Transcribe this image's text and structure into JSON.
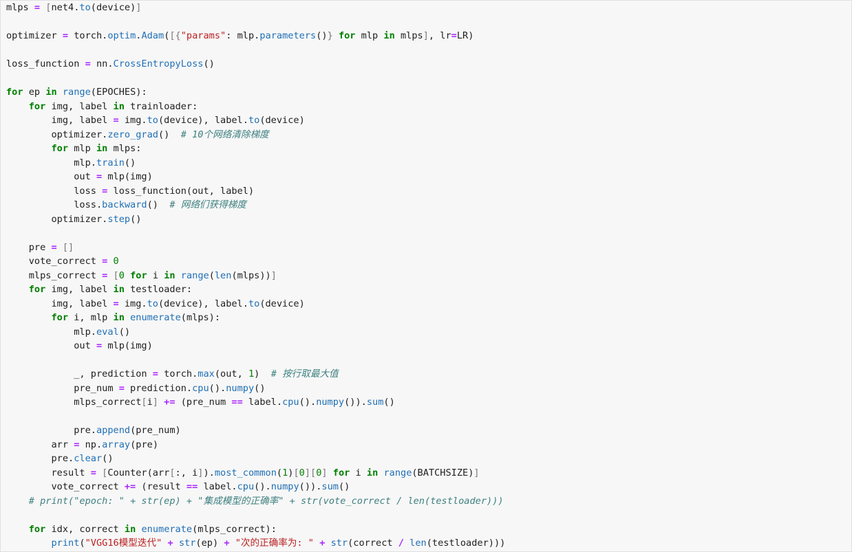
{
  "editor": {
    "lines": [
      [
        [
          "plain",
          "mlps "
        ],
        [
          "op",
          "="
        ],
        [
          "plain",
          " "
        ],
        [
          "br",
          "["
        ],
        [
          "plain",
          "net4."
        ],
        [
          "fn",
          "to"
        ],
        [
          "plain",
          "(device)"
        ],
        [
          "br",
          "]"
        ]
      ],
      [],
      [
        [
          "plain",
          "optimizer "
        ],
        [
          "op",
          "="
        ],
        [
          "plain",
          " torch."
        ],
        [
          "fn",
          "optim"
        ],
        [
          "plain",
          "."
        ],
        [
          "fn",
          "Adam"
        ],
        [
          "plain",
          "("
        ],
        [
          "br",
          "[{"
        ],
        [
          "str",
          "\"params\""
        ],
        [
          "plain",
          ": mlp."
        ],
        [
          "fn",
          "parameters"
        ],
        [
          "plain",
          "()"
        ],
        [
          "br",
          "}"
        ],
        [
          "plain",
          " "
        ],
        [
          "kw",
          "for"
        ],
        [
          "plain",
          " mlp "
        ],
        [
          "kw",
          "in"
        ],
        [
          "plain",
          " mlps"
        ],
        [
          "br",
          "]"
        ],
        [
          "plain",
          ", lr"
        ],
        [
          "op",
          "="
        ],
        [
          "plain",
          "LR)"
        ]
      ],
      [],
      [
        [
          "plain",
          "loss_function "
        ],
        [
          "op",
          "="
        ],
        [
          "plain",
          " nn."
        ],
        [
          "fn",
          "CrossEntropyLoss"
        ],
        [
          "plain",
          "()"
        ]
      ],
      [],
      [
        [
          "kw",
          "for"
        ],
        [
          "plain",
          " ep "
        ],
        [
          "kw",
          "in"
        ],
        [
          "plain",
          " "
        ],
        [
          "fn",
          "range"
        ],
        [
          "plain",
          "(EPOCHES):"
        ]
      ],
      [
        [
          "plain",
          "    "
        ],
        [
          "kw",
          "for"
        ],
        [
          "plain",
          " img, label "
        ],
        [
          "kw",
          "in"
        ],
        [
          "plain",
          " trainloader:"
        ]
      ],
      [
        [
          "plain",
          "        img, label "
        ],
        [
          "op",
          "="
        ],
        [
          "plain",
          " img."
        ],
        [
          "fn",
          "to"
        ],
        [
          "plain",
          "(device), label."
        ],
        [
          "fn",
          "to"
        ],
        [
          "plain",
          "(device)"
        ]
      ],
      [
        [
          "plain",
          "        optimizer."
        ],
        [
          "fn",
          "zero_grad"
        ],
        [
          "plain",
          "()  "
        ],
        [
          "cmt",
          "# 10个网络清除梯度"
        ]
      ],
      [
        [
          "plain",
          "        "
        ],
        [
          "kw",
          "for"
        ],
        [
          "plain",
          " mlp "
        ],
        [
          "kw",
          "in"
        ],
        [
          "plain",
          " mlps:"
        ]
      ],
      [
        [
          "plain",
          "            mlp."
        ],
        [
          "fn",
          "train"
        ],
        [
          "plain",
          "()"
        ]
      ],
      [
        [
          "plain",
          "            out "
        ],
        [
          "op",
          "="
        ],
        [
          "plain",
          " mlp(img)"
        ]
      ],
      [
        [
          "plain",
          "            loss "
        ],
        [
          "op",
          "="
        ],
        [
          "plain",
          " loss_function(out, label)"
        ]
      ],
      [
        [
          "plain",
          "            loss."
        ],
        [
          "fn",
          "backward"
        ],
        [
          "plain",
          "()  "
        ],
        [
          "cmt",
          "# 网络们获得梯度"
        ]
      ],
      [
        [
          "plain",
          "        optimizer."
        ],
        [
          "fn",
          "step"
        ],
        [
          "plain",
          "()"
        ]
      ],
      [],
      [
        [
          "plain",
          "    pre "
        ],
        [
          "op",
          "="
        ],
        [
          "plain",
          " "
        ],
        [
          "br",
          "[]"
        ]
      ],
      [
        [
          "plain",
          "    vote_correct "
        ],
        [
          "op",
          "="
        ],
        [
          "plain",
          " "
        ],
        [
          "num",
          "0"
        ]
      ],
      [
        [
          "plain",
          "    mlps_correct "
        ],
        [
          "op",
          "="
        ],
        [
          "plain",
          " "
        ],
        [
          "br",
          "["
        ],
        [
          "num",
          "0"
        ],
        [
          "plain",
          " "
        ],
        [
          "kw",
          "for"
        ],
        [
          "plain",
          " i "
        ],
        [
          "kw",
          "in"
        ],
        [
          "plain",
          " "
        ],
        [
          "fn",
          "range"
        ],
        [
          "plain",
          "("
        ],
        [
          "fn",
          "len"
        ],
        [
          "plain",
          "(mlps))"
        ],
        [
          "br",
          "]"
        ]
      ],
      [
        [
          "plain",
          "    "
        ],
        [
          "kw",
          "for"
        ],
        [
          "plain",
          " img, label "
        ],
        [
          "kw",
          "in"
        ],
        [
          "plain",
          " testloader:"
        ]
      ],
      [
        [
          "plain",
          "        img, label "
        ],
        [
          "op",
          "="
        ],
        [
          "plain",
          " img."
        ],
        [
          "fn",
          "to"
        ],
        [
          "plain",
          "(device), label."
        ],
        [
          "fn",
          "to"
        ],
        [
          "plain",
          "(device)"
        ]
      ],
      [
        [
          "plain",
          "        "
        ],
        [
          "kw",
          "for"
        ],
        [
          "plain",
          " i, mlp "
        ],
        [
          "kw",
          "in"
        ],
        [
          "plain",
          " "
        ],
        [
          "fn",
          "enumerate"
        ],
        [
          "plain",
          "(mlps):"
        ]
      ],
      [
        [
          "plain",
          "            mlp."
        ],
        [
          "fn",
          "eval"
        ],
        [
          "plain",
          "()"
        ]
      ],
      [
        [
          "plain",
          "            out "
        ],
        [
          "op",
          "="
        ],
        [
          "plain",
          " mlp(img)"
        ]
      ],
      [],
      [
        [
          "plain",
          "            _, prediction "
        ],
        [
          "op",
          "="
        ],
        [
          "plain",
          " torch."
        ],
        [
          "fn",
          "max"
        ],
        [
          "plain",
          "(out, "
        ],
        [
          "num",
          "1"
        ],
        [
          "plain",
          ")  "
        ],
        [
          "cmt",
          "# 按行取最大值"
        ]
      ],
      [
        [
          "plain",
          "            pre_num "
        ],
        [
          "op",
          "="
        ],
        [
          "plain",
          " prediction."
        ],
        [
          "fn",
          "cpu"
        ],
        [
          "plain",
          "()."
        ],
        [
          "fn",
          "numpy"
        ],
        [
          "plain",
          "()"
        ]
      ],
      [
        [
          "plain",
          "            mlps_correct"
        ],
        [
          "br",
          "["
        ],
        [
          "plain",
          "i"
        ],
        [
          "br",
          "]"
        ],
        [
          "plain",
          " "
        ],
        [
          "op",
          "+="
        ],
        [
          "plain",
          " (pre_num "
        ],
        [
          "op",
          "=="
        ],
        [
          "plain",
          " label."
        ],
        [
          "fn",
          "cpu"
        ],
        [
          "plain",
          "()."
        ],
        [
          "fn",
          "numpy"
        ],
        [
          "plain",
          "())."
        ],
        [
          "fn",
          "sum"
        ],
        [
          "plain",
          "()"
        ]
      ],
      [],
      [
        [
          "plain",
          "            pre."
        ],
        [
          "fn",
          "append"
        ],
        [
          "plain",
          "(pre_num)"
        ]
      ],
      [
        [
          "plain",
          "        arr "
        ],
        [
          "op",
          "="
        ],
        [
          "plain",
          " np."
        ],
        [
          "fn",
          "array"
        ],
        [
          "plain",
          "(pre)"
        ]
      ],
      [
        [
          "plain",
          "        pre."
        ],
        [
          "fn",
          "clear"
        ],
        [
          "plain",
          "()"
        ]
      ],
      [
        [
          "plain",
          "        result "
        ],
        [
          "op",
          "="
        ],
        [
          "plain",
          " "
        ],
        [
          "br",
          "["
        ],
        [
          "plain",
          "Counter(arr"
        ],
        [
          "br",
          "["
        ],
        [
          "plain",
          ":, i"
        ],
        [
          "br",
          "]"
        ],
        [
          "plain",
          ")."
        ],
        [
          "fn",
          "most_common"
        ],
        [
          "plain",
          "("
        ],
        [
          "num",
          "1"
        ],
        [
          "plain",
          ")"
        ],
        [
          "br",
          "["
        ],
        [
          "num",
          "0"
        ],
        [
          "br",
          "]["
        ],
        [
          "num",
          "0"
        ],
        [
          "br",
          "]"
        ],
        [
          "plain",
          " "
        ],
        [
          "kw",
          "for"
        ],
        [
          "plain",
          " i "
        ],
        [
          "kw",
          "in"
        ],
        [
          "plain",
          " "
        ],
        [
          "fn",
          "range"
        ],
        [
          "plain",
          "(BATCHSIZE)"
        ],
        [
          "br",
          "]"
        ]
      ],
      [
        [
          "plain",
          "        vote_correct "
        ],
        [
          "op",
          "+="
        ],
        [
          "plain",
          " (result "
        ],
        [
          "op",
          "=="
        ],
        [
          "plain",
          " label."
        ],
        [
          "fn",
          "cpu"
        ],
        [
          "plain",
          "()."
        ],
        [
          "fn",
          "numpy"
        ],
        [
          "plain",
          "())."
        ],
        [
          "fn",
          "sum"
        ],
        [
          "plain",
          "()"
        ]
      ],
      [
        [
          "plain",
          "    "
        ],
        [
          "cmt",
          "# print(\"epoch: \" + str(ep) + \"集成模型的正确率\" + str(vote_correct / len(testloader)))"
        ]
      ],
      [],
      [
        [
          "plain",
          "    "
        ],
        [
          "kw",
          "for"
        ],
        [
          "plain",
          " idx, correct "
        ],
        [
          "kw",
          "in"
        ],
        [
          "plain",
          " "
        ],
        [
          "fn",
          "enumerate"
        ],
        [
          "plain",
          "(mlps_correct):"
        ]
      ],
      [
        [
          "plain",
          "        "
        ],
        [
          "fn",
          "print"
        ],
        [
          "plain",
          "("
        ],
        [
          "str",
          "\"VGG16模型迭代\""
        ],
        [
          "plain",
          " "
        ],
        [
          "op",
          "+"
        ],
        [
          "plain",
          " "
        ],
        [
          "fn",
          "str"
        ],
        [
          "plain",
          "(ep) "
        ],
        [
          "op",
          "+"
        ],
        [
          "plain",
          " "
        ],
        [
          "str",
          "\"次的正确率为: \""
        ],
        [
          "plain",
          " "
        ],
        [
          "op",
          "+"
        ],
        [
          "plain",
          " "
        ],
        [
          "fn",
          "str"
        ],
        [
          "plain",
          "(correct "
        ],
        [
          "op",
          "/"
        ],
        [
          "plain",
          " "
        ],
        [
          "fn",
          "len"
        ],
        [
          "plain",
          "(testloader)))"
        ]
      ]
    ]
  }
}
